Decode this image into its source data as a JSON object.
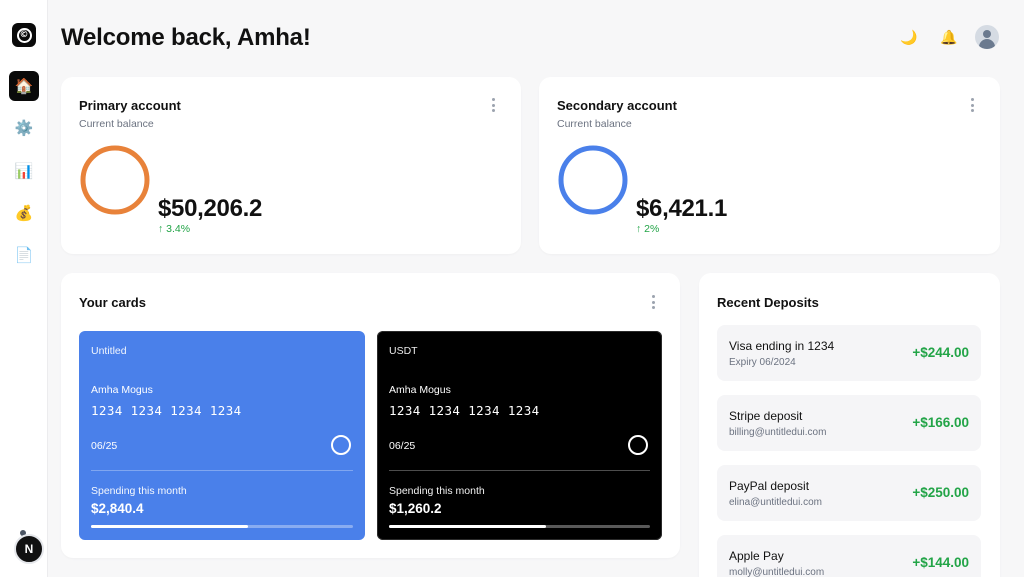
{
  "header": {
    "title": "Welcome back, Amha!"
  },
  "sidebar": {
    "logo": "©",
    "items": [
      {
        "name": "home",
        "icon": "🏠",
        "active": true
      },
      {
        "name": "settings",
        "icon": "⚙️",
        "active": false
      },
      {
        "name": "analytics",
        "icon": "📊",
        "active": false
      },
      {
        "name": "finance",
        "icon": "💰",
        "active": false
      },
      {
        "name": "documents",
        "icon": "📄",
        "active": false
      }
    ],
    "bottom_avatar": "N"
  },
  "header_icons": {
    "theme": "🌙",
    "notifications": "🔔"
  },
  "accounts": [
    {
      "title": "Primary account",
      "subtitle": "Current balance",
      "balance": "$50,206.2",
      "change": "↑ 3.4%",
      "ring_color": "#e8823a"
    },
    {
      "title": "Secondary account",
      "subtitle": "Current balance",
      "balance": "$6,421.1",
      "change": "↑ 2%",
      "ring_color": "#4a80ea"
    }
  ],
  "cards_section": {
    "title": "Your cards",
    "cards": [
      {
        "label": "Untitled",
        "holder": "Amha Mogus",
        "number": "1234 1234 1234 1234",
        "expiry": "06/25",
        "spending_label": "Spending this month",
        "spending_value": "$2,840.4",
        "spending_progress": 0.6,
        "background": "#4a80ea"
      },
      {
        "label": "USDT",
        "holder": "Amha Mogus",
        "number": "1234 1234 1234 1234",
        "expiry": "06/25",
        "spending_label": "Spending this month",
        "spending_value": "$1,260.2",
        "spending_progress": 0.6,
        "background": "#000000"
      }
    ]
  },
  "deposits": {
    "title": "Recent Deposits",
    "items": [
      {
        "name": "Visa ending in 1234",
        "detail": "Expiry 06/2024",
        "amount": "+$244.00"
      },
      {
        "name": "Stripe deposit",
        "detail": "billing@untitledui.com",
        "amount": "+$166.00"
      },
      {
        "name": "PayPal deposit",
        "detail": "elina@untitledui.com",
        "amount": "+$250.00"
      },
      {
        "name": "Apple Pay",
        "detail": "molly@untitledui.com",
        "amount": "+$144.00"
      }
    ]
  }
}
